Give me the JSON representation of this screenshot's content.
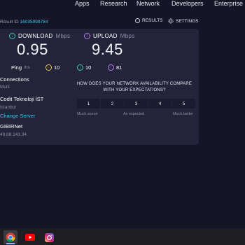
{
  "nav": {
    "items": [
      "Apps",
      "Research",
      "Network",
      "Developers",
      "Enterprise"
    ]
  },
  "result": {
    "id_label": "Result ID",
    "id_value": "16035998784",
    "results_label": "RESULTS",
    "settings_label": "SETTINGS"
  },
  "download": {
    "label": "DOWNLOAD",
    "unit": "Mbps",
    "value": "0.95"
  },
  "upload": {
    "label": "UPLOAD",
    "unit": "Mbps",
    "value": "9.45"
  },
  "ping": {
    "label": "Ping",
    "unit": "ms",
    "idle": "10",
    "download_latency": "10",
    "upload_latency": "81"
  },
  "connection": {
    "connections_label": "Connections",
    "connections_value": "Multi",
    "host": "Codit Teknoloji İST",
    "city": "Istanbul",
    "change_server": "Change Server",
    "isp": "GIBIRNet",
    "ip": "49.88.143.34"
  },
  "survey": {
    "question": "HOW DOES YOUR NETWORK AVAILABILITY COMPARE WITH YOUR EXPECTATIONS?",
    "options": [
      "1",
      "2",
      "3",
      "4",
      "5"
    ],
    "low_label": "Much worse",
    "mid_label": "As expected",
    "high_label": "Much better"
  },
  "colors": {
    "download": "#3cc6b0",
    "upload": "#b77ff0",
    "idle": "#e6c84a",
    "link": "#3ec0e8"
  },
  "taskbar": {
    "apps": [
      "chrome-icon",
      "youtube-icon",
      "instagram-icon"
    ]
  }
}
